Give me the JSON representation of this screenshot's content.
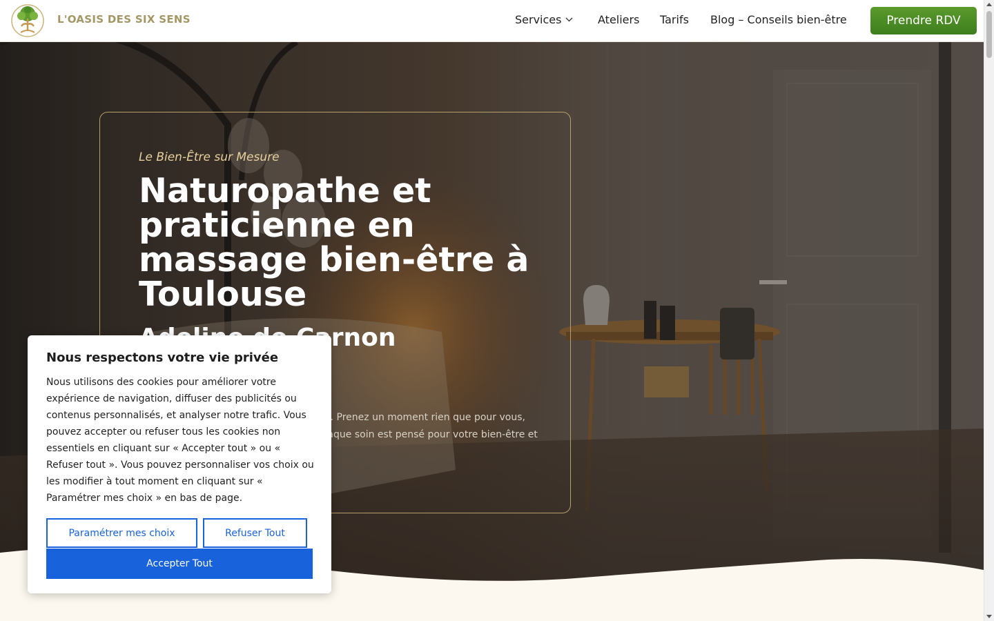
{
  "header": {
    "brand": "L'OASIS DES SIX SENS",
    "nav": [
      {
        "label": "Services",
        "has_dropdown": true
      },
      {
        "label": "Ateliers"
      },
      {
        "label": "Tarifs"
      },
      {
        "label": "Blog – Conseils bien-être"
      }
    ],
    "cta_label": "Prendre RDV"
  },
  "hero": {
    "tagline": "Le Bien-Être sur Mesure",
    "title": "Naturopathe et praticienne en massage bien-être à Toulouse",
    "subtitle": "Adeline de Carnon",
    "text": "Retrouvez un corps plus léger et apaisé. Prenez un moment rien que pour vous, au cœur de la nature à Toulouse, où chaque soin est pensé pour votre bien-être et votre vitalité."
  },
  "cookie_banner": {
    "title": "Nous respectons votre vie privée",
    "body": "Nous utilisons des cookies pour améliorer votre expérience de navigation, diffuser des publicités ou contenus personnalisés, et analyser notre trafic. Vous pouvez accepter ou refuser tous les cookies non essentiels en cliquant sur « Accepter tout » ou « Refuser tout ». Vous pouvez personnaliser vos choix ou les modifier à tout moment en cliquant sur « Paramétrer mes choix » en bas de page.",
    "customize_label": "Paramétrer mes choix",
    "refuse_label": "Refuser Tout",
    "accept_label": "Accepter Tout"
  },
  "colors": {
    "brand": "#a39765",
    "cta_green": "#4a8c24",
    "cookie_blue": "#1863dc",
    "cream": "#fdf8ef",
    "card_border": "#b9a06b"
  },
  "icons": {
    "logo": "tree-of-life-logo-icon",
    "services_dropdown": "chevron-down-icon"
  }
}
